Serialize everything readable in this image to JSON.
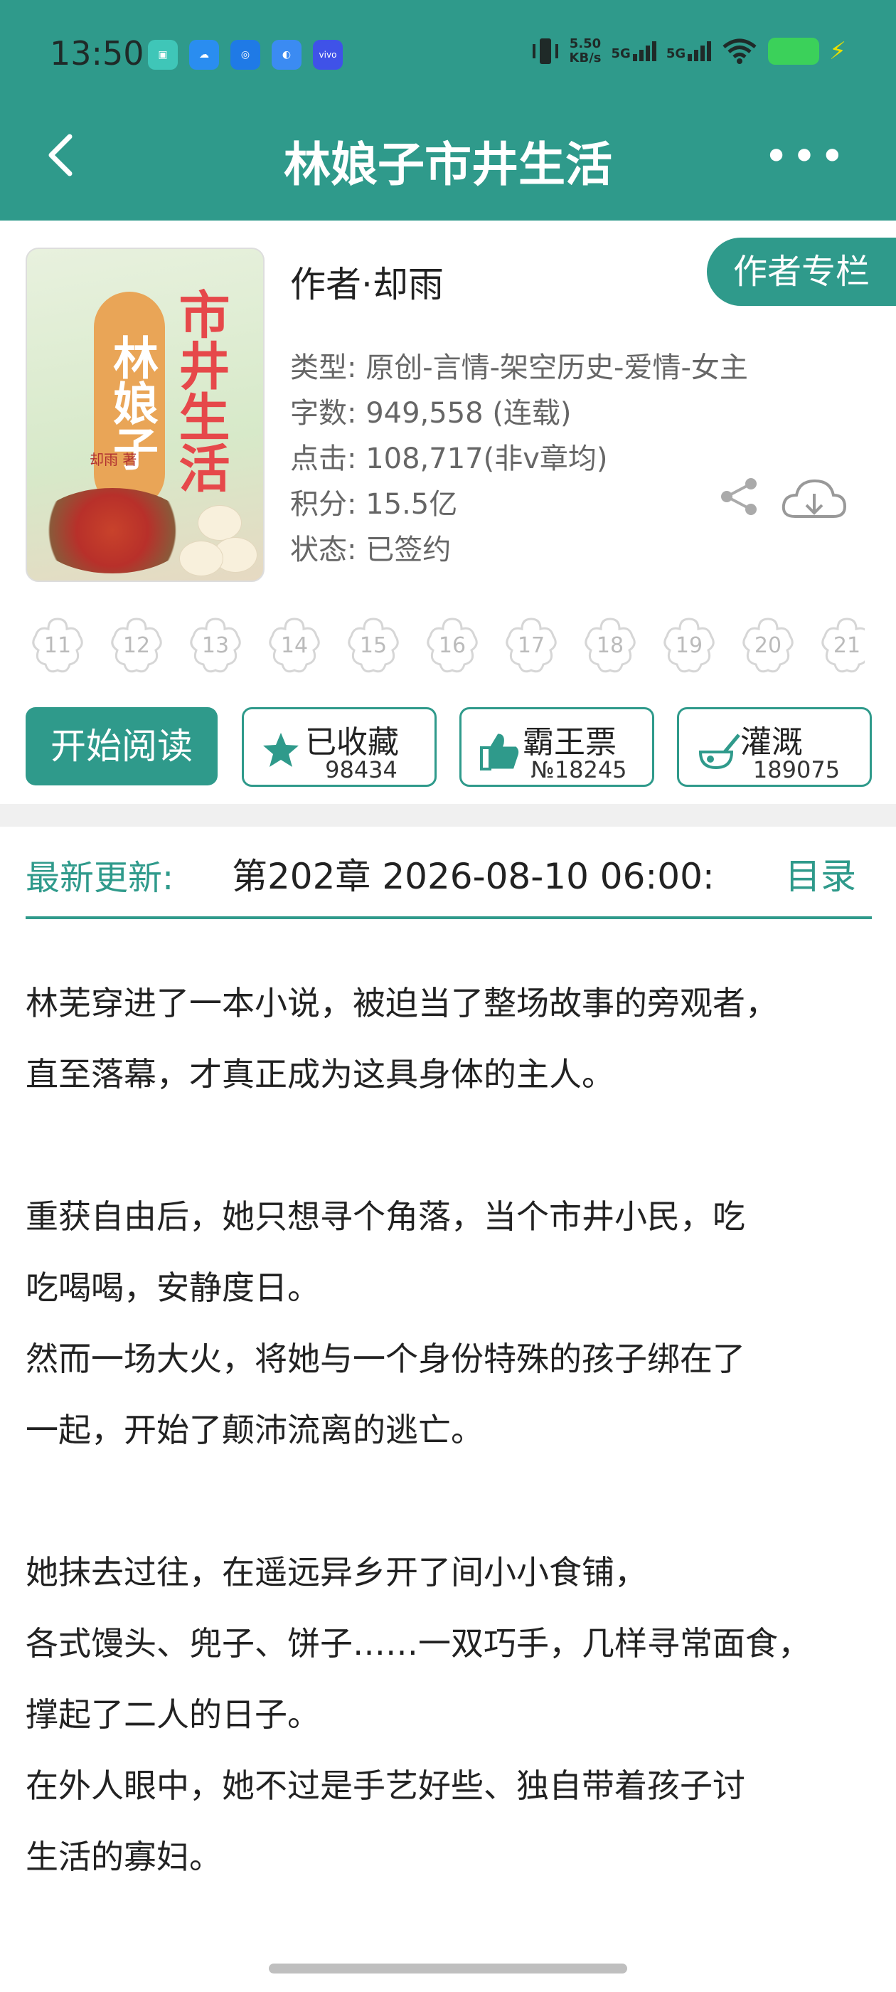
{
  "status_bar": {
    "time": "13:50",
    "net_speed_value": "5.50",
    "net_speed_unit": "KB/s",
    "sim1": "5G",
    "sim2": "5G",
    "app_icons": [
      "messages-icon",
      "cloud-icon",
      "browser-icon",
      "assistant-icon",
      "vivo-icon"
    ],
    "vivo_label": "vivo"
  },
  "header": {
    "title": "林娘子市井生活"
  },
  "book": {
    "cover_title_a": "林娘子",
    "cover_title_b": "市井生活",
    "cover_author": "却雨 著",
    "author": "作者·却雨",
    "author_column_label": "作者专栏",
    "type": "类型: 原创-言情-架空历史-爱情-女主",
    "word_count": "字数: 949,558 (连载)",
    "clicks": "点击: 108,717(非v章均)",
    "points": "积分: 15.5亿",
    "status": "状态: 已签约"
  },
  "flower_levels": [
    "11",
    "12",
    "13",
    "14",
    "15",
    "16",
    "17",
    "18",
    "19",
    "20",
    "21"
  ],
  "actions": {
    "read_label": "开始阅读",
    "collect_label": "已收藏",
    "collect_count": "98434",
    "ticket_label": "霸王票",
    "ticket_count": "№18245",
    "irrigate_label": "灌溉",
    "irrigate_count": "189075"
  },
  "latest_update": {
    "label": "最新更新:",
    "text": "第202章  2026-08-10 06:00:",
    "toc_label": "目录"
  },
  "description": [
    "林芜穿进了一本小说，被迫当了整场故事的旁观者，",
    "直至落幕，才真正成为这具身体的主人。",
    "",
    "重获自由后，她只想寻个角落，当个市井小民，吃",
    "吃喝喝，安静度日。",
    "然而一场大火，将她与一个身份特殊的孩子绑在了",
    "一起，开始了颠沛流离的逃亡。",
    "",
    "她抹去过往，在遥远异乡开了间小小食铺，",
    "各式馒头、兜子、饼子……一双巧手，几样寻常面食，",
    "撑起了二人的日子。",
    "在外人眼中，她不过是手艺好些、独自带着孩子讨",
    "生活的寡妇。"
  ],
  "colors": {
    "accent": "#2f9a8b",
    "header_bg": "#2f9a8b",
    "meta_text": "#666666"
  }
}
